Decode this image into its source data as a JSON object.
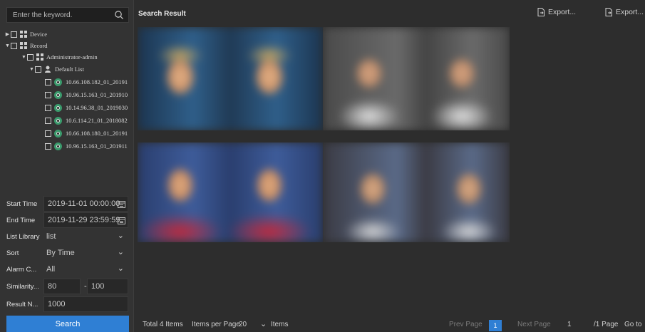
{
  "search": {
    "placeholder": "Enter the keyword."
  },
  "tree": {
    "device": "Device",
    "record": "Record",
    "admin": "Administrator-admin",
    "default_list": "Default List",
    "items": [
      "10.66.108.182_01_20191",
      "10.96.15.163_01_201910",
      "10.14.96.38_01_2019030",
      "10.6.114.21_01_2018082",
      "10.66.108.180_01_20191",
      "10.96.15.163_01_201911"
    ]
  },
  "form": {
    "start_time_label": "Start Time",
    "start_time_value": "2019-11-01 00:00:00",
    "end_time_label": "End Time",
    "end_time_value": "2019-11-29 23:59:59",
    "list_library_label": "List Library",
    "list_library_value": "list",
    "sort_label": "Sort",
    "sort_value": "By Time",
    "alarm_label": "Alarm C...",
    "alarm_value": "All",
    "similarity_label": "Similarity...",
    "similarity_min": "80",
    "similarity_sep": "-",
    "similarity_max": "100",
    "result_label": "Result N...",
    "result_value": "1000",
    "search_button": "Search"
  },
  "main": {
    "title": "Search Result",
    "export1": "Export...",
    "export2": "Export..."
  },
  "pager": {
    "total": "Total 4 Items",
    "per_page_label": "Items per Page",
    "per_page_value": "20",
    "items_label": "Items",
    "prev": "Prev Page",
    "current": "1",
    "next": "Next Page",
    "goto_value": "1",
    "page_total": "/1 Page",
    "goto": "Go to"
  },
  "colors": {
    "accent": "#2f7fd4",
    "camera": "#3a9a6c"
  },
  "icons": [
    "search-icon",
    "calendar-icon",
    "chevron-down-icon",
    "export-icon",
    "group-icon",
    "person-icon",
    "camera-icon"
  ]
}
